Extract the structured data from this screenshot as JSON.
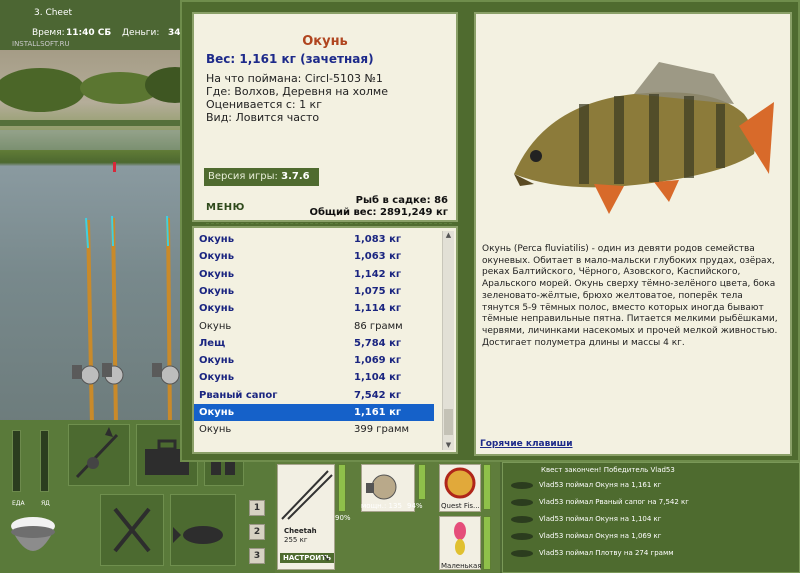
{
  "topbar": {
    "title": "3. Cheet",
    "time_label": "Время:",
    "time_value": "11:40 СБ",
    "money_label": "Деньги:",
    "money_value": "34",
    "watermark": "INSTALLSOFT.RU"
  },
  "fish_card": {
    "name": "Окунь",
    "weight": "Вес: 1,161 кг (зачетная)",
    "bait": "На что поймана: Circl-5103 №1",
    "place": "Где: Волхов, Деревня на холме",
    "rated": "Оценивается с: 1 кг",
    "kind": "Вид: Ловится часто"
  },
  "version": {
    "label": "Версия игры:",
    "value": "3.7.6"
  },
  "menu_label": "МЕНЮ",
  "sadok": {
    "count": "Рыб в садке: 86",
    "total": "Общий вес: 2891,249 кг"
  },
  "catch_list": [
    {
      "name": "Окунь",
      "weight": "1,083 кг",
      "style": "bold"
    },
    {
      "name": "Окунь",
      "weight": "1,063 кг",
      "style": "bold"
    },
    {
      "name": "Окунь",
      "weight": "1,142 кг",
      "style": "bold"
    },
    {
      "name": "Окунь",
      "weight": "1,075 кг",
      "style": "bold"
    },
    {
      "name": "Окунь",
      "weight": "1,114 кг",
      "style": "bold"
    },
    {
      "name": "Окунь",
      "weight": "86 грамм",
      "style": "plain"
    },
    {
      "name": "Лещ",
      "weight": "5,784 кг",
      "style": "bold"
    },
    {
      "name": "Окунь",
      "weight": "1,069 кг",
      "style": "bold"
    },
    {
      "name": "Окунь",
      "weight": "1,104 кг",
      "style": "bold"
    },
    {
      "name": "Рваный сапог",
      "weight": "7,542 кг",
      "style": "bold"
    },
    {
      "name": "Окунь",
      "weight": "1,161 кг",
      "style": "sel"
    },
    {
      "name": "Окунь",
      "weight": "399 грамм",
      "style": "plain"
    }
  ],
  "description": "Окунь (Perca fluviatilis) - один из девяти родов семейства окуневых. Обитает в мало-мальски глубоких прудах, озёрах, реках Балтийского, Чёрного, Азовского, Каспийского, Аральского морей. Окунь сверху тёмно-зелёного цвета, бока зеленовато-жёлтые, брюхо желтоватое, поперёк тела тянутся 5-9 тёмных полос, вместо которых иногда бывают тёмные неправильные пятна. Питается мелкими рыбёшками, червями, личинками насекомых и прочей мелкой живностью. Достигает полуметра длины и массы 4 кг.",
  "hotkeys_label": "Горячие клавиши",
  "controls": {
    "gauge_food": "ЕДА",
    "gauge_poison": "ЯД",
    "num1": "1",
    "num2": "2",
    "num3": "3"
  },
  "gear": {
    "rod_name": "Cheetah",
    "rod_weight": "255 кг",
    "rod_pct": "90%",
    "setup_button": "НАСТРОИТЬ",
    "reel_power": "мощн.: 135",
    "reel_pct": "94%",
    "line_name": "Quest Fis...",
    "bait_name": "Маленькая"
  },
  "news": {
    "header": "Квест закончен! Победитель Vlad53",
    "items": [
      "Vlad53 поймал Окуня на 1,161 кг",
      "Vlad53 поймал Рваный сапог на 7,542 кг",
      "Vlad53 поймал Окуня на 1,104 кг",
      "Vlad53 поймал Окуня на 1,069 кг",
      "Vlad53 поймал Плотву на 274 грамм"
    ]
  }
}
